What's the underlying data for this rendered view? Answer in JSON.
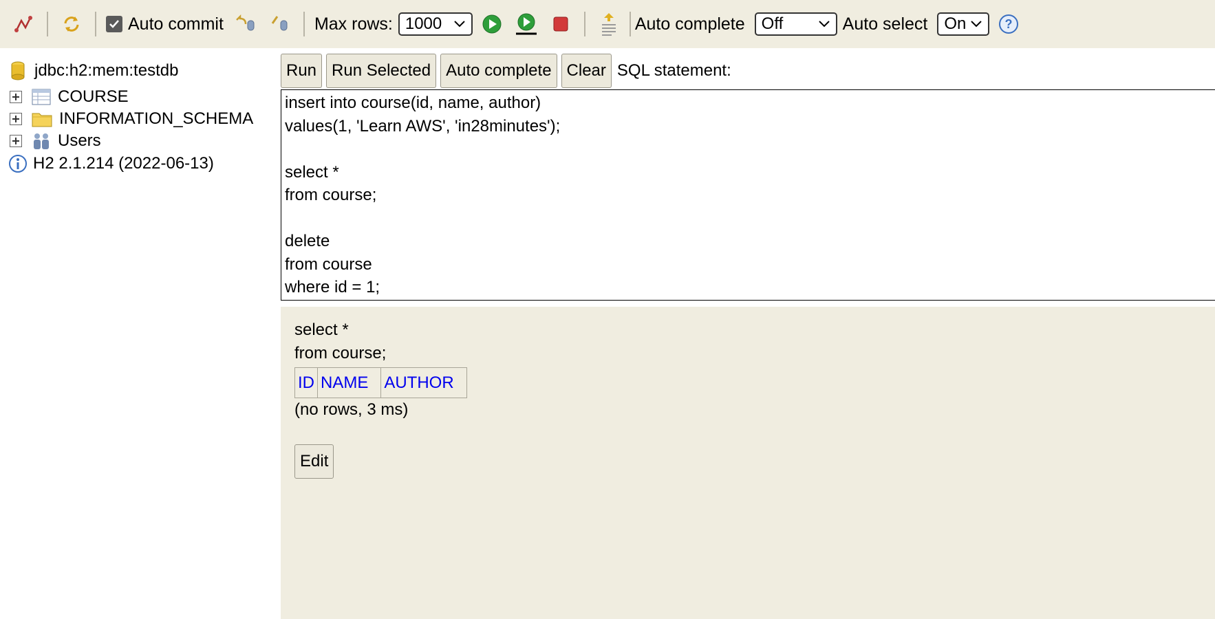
{
  "toolbar": {
    "auto_commit_label": "Auto commit",
    "auto_commit_checked": true,
    "max_rows_label": "Max rows:",
    "max_rows_value": "1000",
    "auto_complete_label": "Auto complete",
    "auto_complete_value": "Off",
    "auto_select_label": "Auto select",
    "auto_select_value": "On",
    "help_symbol": "?"
  },
  "tree": {
    "connection": "jdbc:h2:mem:testdb",
    "items": [
      {
        "label": "COURSE",
        "icon": "table-icon"
      },
      {
        "label": "INFORMATION_SCHEMA",
        "icon": "folder-icon"
      },
      {
        "label": "Users",
        "icon": "users-icon"
      }
    ],
    "version": "H2 2.1.214 (2022-06-13)"
  },
  "query": {
    "run_label": "Run",
    "run_selected_label": "Run Selected",
    "auto_complete_label": "Auto complete",
    "clear_label": "Clear",
    "statement_label": "SQL statement:",
    "sql_text": "insert into course(id, name, author)\nvalues(1, 'Learn AWS', 'in28minutes');\n\nselect *\nfrom course;\n\ndelete\nfrom course\nwhere id = 1;"
  },
  "result": {
    "statement_line1": "select *",
    "statement_line2": "from course;",
    "columns": [
      "ID",
      "NAME",
      "AUTHOR"
    ],
    "status": "(no rows, 3 ms)",
    "edit_label": "Edit"
  },
  "colors": {
    "toolbar_bg": "#f0ede0",
    "result_bg": "#f0ede0",
    "link_blue": "#0000ee",
    "run_green": "#2e9e3a",
    "stop_red": "#d23a3a"
  }
}
